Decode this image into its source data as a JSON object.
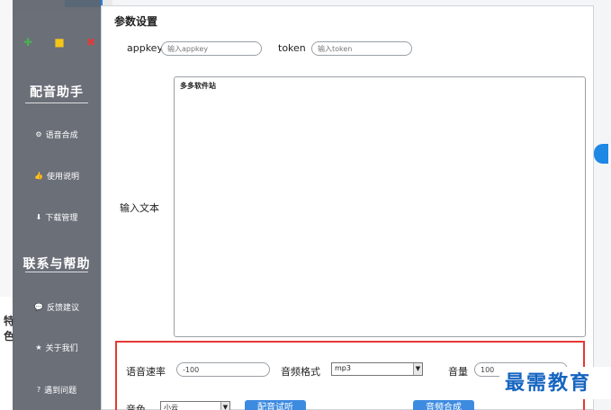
{
  "sidebar": {
    "window_icons": [
      "green-dot",
      "yellow-square",
      "red-close"
    ],
    "section1_title": "配音助手",
    "items1": [
      {
        "label": "语音合成",
        "icon": "gear-icon"
      },
      {
        "label": "使用说明",
        "icon": "thumb-icon"
      },
      {
        "label": "下载管理",
        "icon": "download-icon"
      }
    ],
    "section2_title": "联系与帮助",
    "items2": [
      {
        "label": "反馈建议",
        "icon": "chat-icon"
      },
      {
        "label": "关于我们",
        "icon": "star-icon"
      },
      {
        "label": "遇到问题",
        "icon": "question-icon"
      }
    ]
  },
  "dialog": {
    "title": "参数设置",
    "appkey_label": "appkey",
    "appkey_placeholder": "输入appkey",
    "token_label": "token",
    "token_placeholder": "输入token",
    "text_label": "输入文本",
    "text_value": "多多软件站",
    "speed_label": "语音速率",
    "speed_value": "-100",
    "format_label": "音频格式",
    "format_value": "mp3",
    "volume_label": "音量",
    "volume_value": "100",
    "voice_label": "音色",
    "voice_value": "小云",
    "preview_button": "配音试听",
    "synth_button": "音频合成"
  },
  "background": {
    "left_text": "特色"
  },
  "watermark": "最需教育",
  "colors": {
    "sidebar": "#5f646e",
    "accent": "#3d8be0",
    "highlight_border": "#e53935"
  }
}
